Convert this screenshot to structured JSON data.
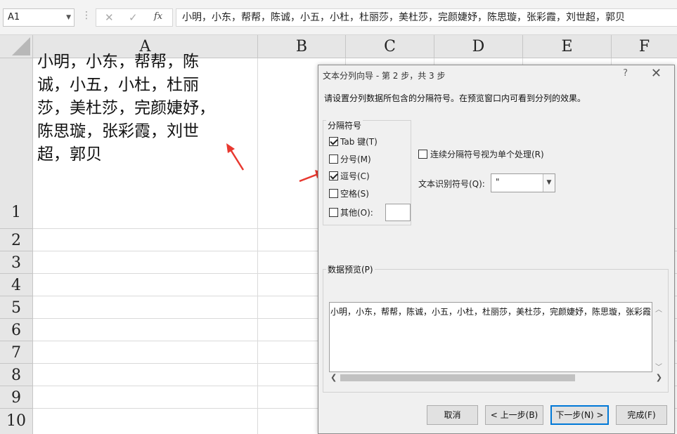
{
  "formula_bar": {
    "name_box": "A1",
    "fx_label": "fx",
    "content": "小明，小东，帮帮，陈诚，小五，小杜，杜丽莎，美杜莎，完颜婕妤，陈思璇，张彩霞，刘世超，郭贝"
  },
  "grid": {
    "columns": [
      "A",
      "B",
      "C",
      "D",
      "E",
      "F"
    ],
    "rows": [
      "1",
      "2",
      "3",
      "4",
      "5",
      "6",
      "7",
      "8",
      "9",
      "10"
    ],
    "cell_a1": "小明，小东，帮帮，陈诚，小五，小杜，杜丽莎，美杜莎，完颜婕妤，陈思璇，张彩霞，刘世超，郭贝"
  },
  "dialog": {
    "title": "文本分列向导 - 第 2 步，共 3 步",
    "help": "?",
    "close": "✕",
    "instruction": "请设置分列数据所包含的分隔符号。在预览窗口内可看到分列的效果。",
    "delimiters_title": "分隔符号",
    "delimiters": [
      {
        "label": "Tab 键(T)",
        "checked": true
      },
      {
        "label": "分号(M)",
        "checked": false
      },
      {
        "label": "逗号(C)",
        "checked": true
      },
      {
        "label": "空格(S)",
        "checked": false
      },
      {
        "label": "其他(O):",
        "checked": false
      }
    ],
    "consecutive_label": "连续分隔符号视为单个处理(R)",
    "qualifier_label": "文本识别符号(Q):",
    "qualifier_value": "\"",
    "preview_title": "数据预览(P)",
    "preview_text": "小明，小东，帮帮，陈诚，小五，小杜，杜丽莎，美杜莎，完颜婕妤，陈思璇，张彩霞",
    "buttons": {
      "cancel": "取消",
      "back": "< 上一步(B)",
      "next": "下一步(N) >",
      "finish": "完成(F)"
    }
  },
  "colors": {
    "arrow": "#e8382f",
    "accent": "#0078d7"
  }
}
